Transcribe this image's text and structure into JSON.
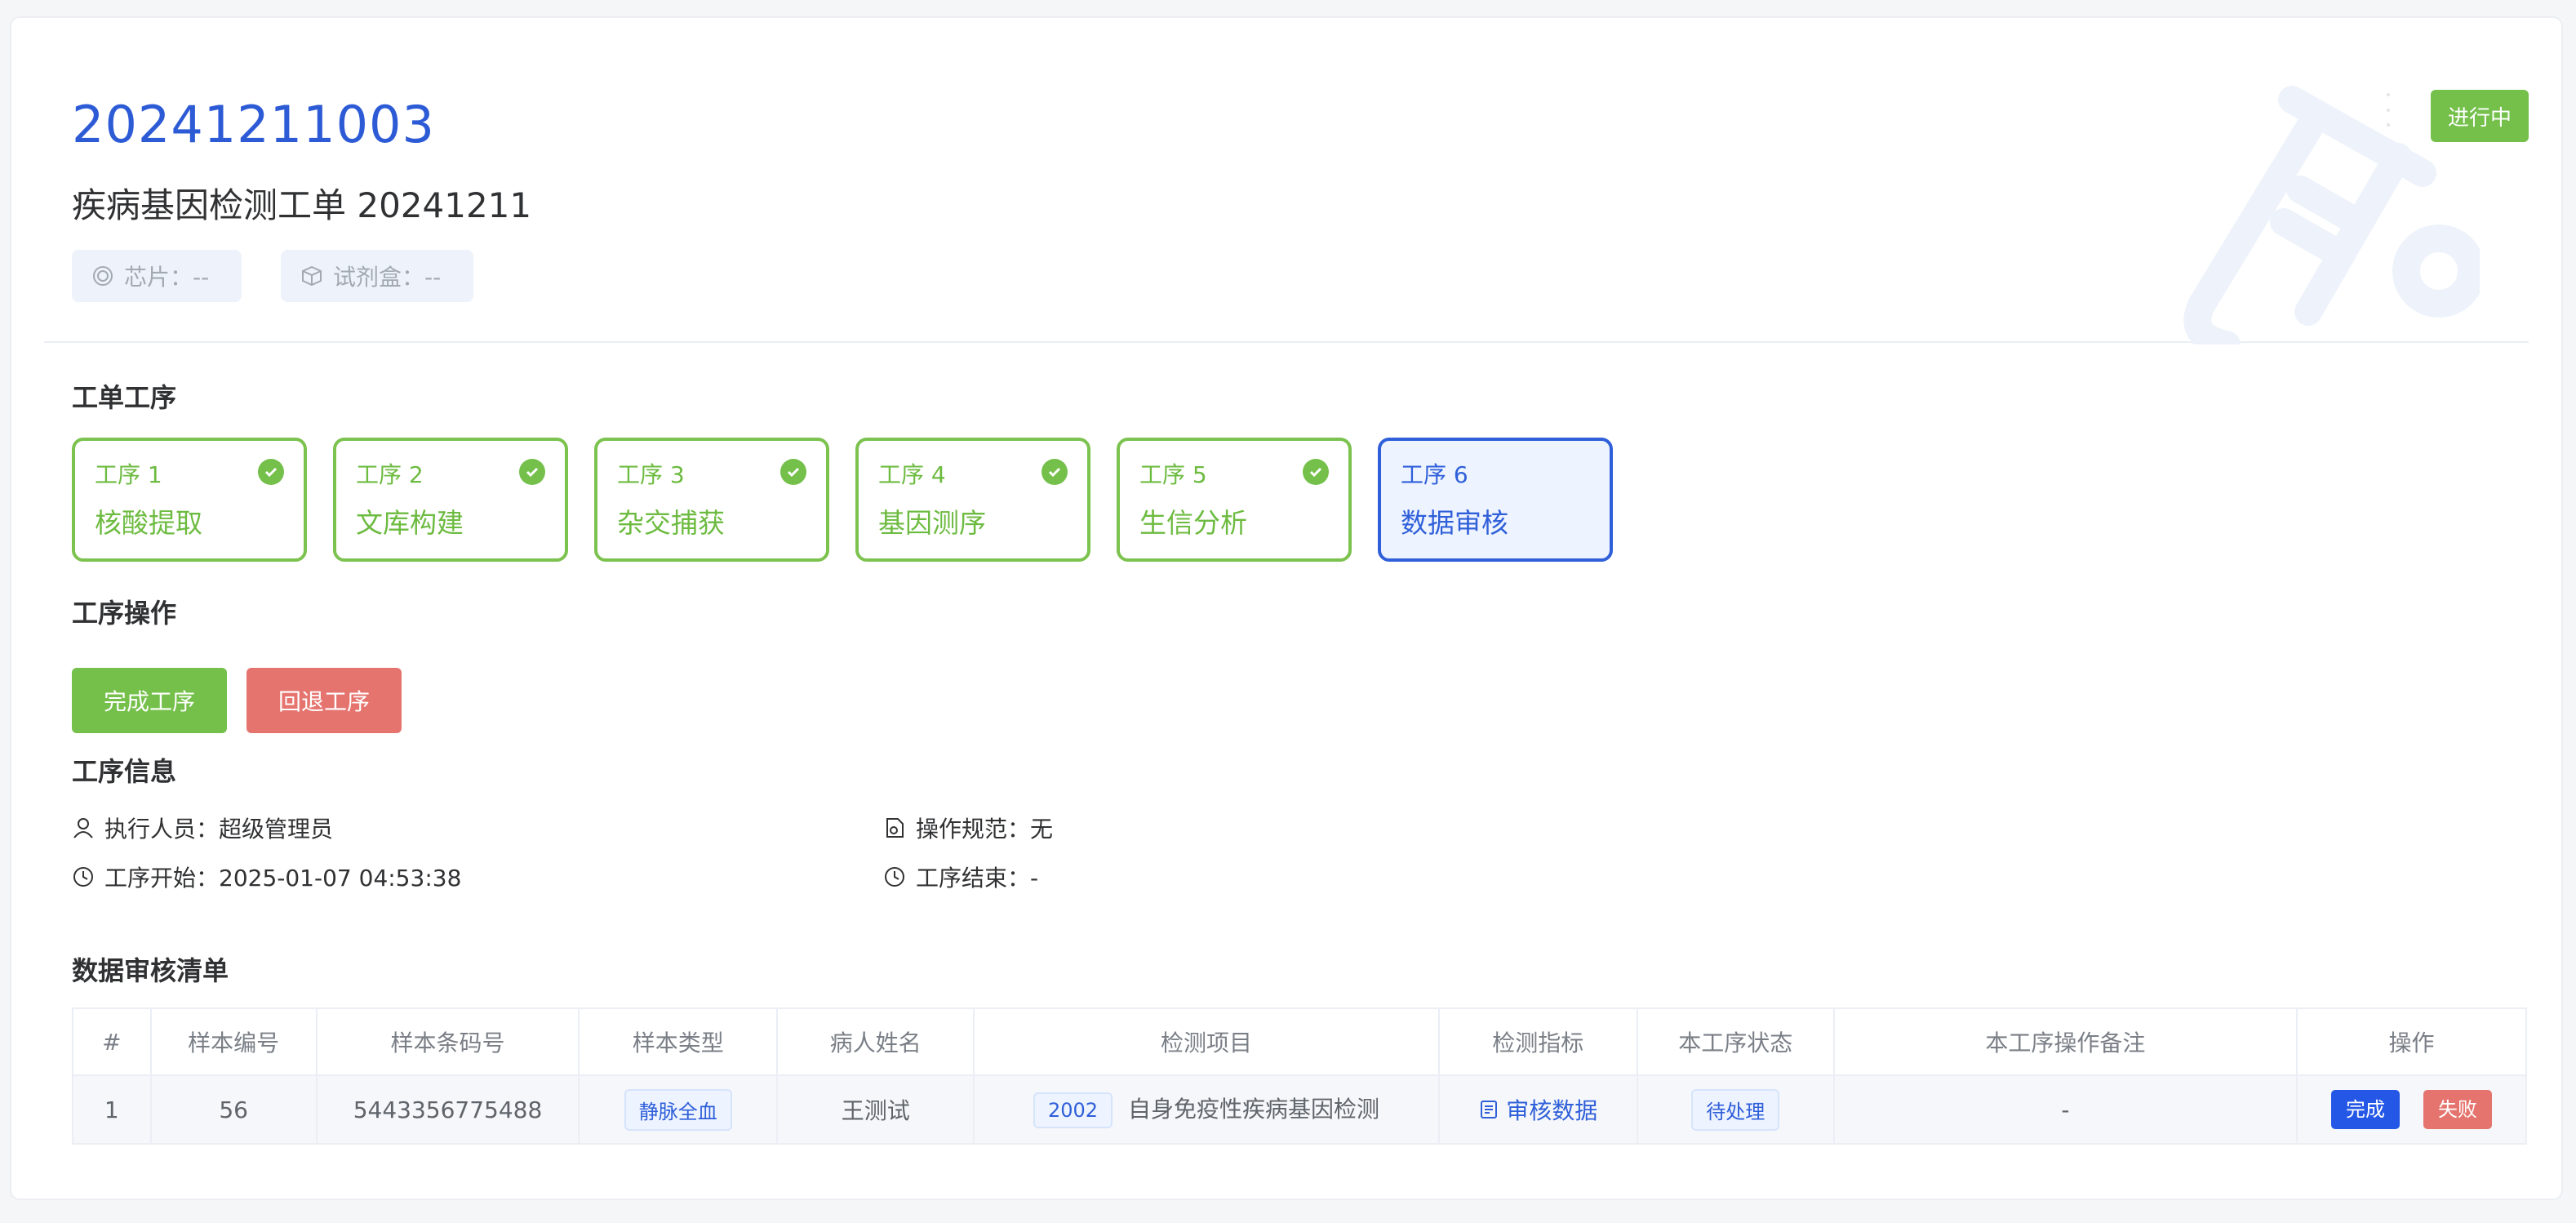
{
  "header": {
    "order_no": "20241211003",
    "order_title": "疾病基因检测工单 20241211",
    "chip": "芯片：--",
    "kit": "试剂盒：--",
    "status": "进行中"
  },
  "steps_section": {
    "title": "工单工序",
    "steps": [
      {
        "num": "工序 1",
        "name": "核酸提取",
        "done": true
      },
      {
        "num": "工序 2",
        "name": "文库构建",
        "done": true
      },
      {
        "num": "工序 3",
        "name": "杂交捕获",
        "done": true
      },
      {
        "num": "工序 4",
        "name": "基因测序",
        "done": true
      },
      {
        "num": "工序 5",
        "name": "生信分析",
        "done": true
      },
      {
        "num": "工序 6",
        "name": "数据审核",
        "done": false
      }
    ]
  },
  "operations": {
    "title": "工序操作",
    "complete_label": "完成工序",
    "rollback_label": "回退工序"
  },
  "info": {
    "title": "工序信息",
    "executor": "执行人员：超级管理员",
    "spec": "操作规范：无",
    "start": "工序开始：2025-01-07 04:53:38",
    "end": "工序结束：-"
  },
  "review": {
    "title": "数据审核清单",
    "columns": [
      "#",
      "样本编号",
      "样本条码号",
      "样本类型",
      "病人姓名",
      "检测项目",
      "检测指标",
      "本工序状态",
      "本工序操作备注",
      "操作"
    ],
    "rows": [
      {
        "index": "1",
        "sample_no": "56",
        "barcode": "5443356775488",
        "sample_type": "静脉全血",
        "patient": "王测试",
        "project_code": "2002",
        "project_name": "自身免疫性疾病基因检测",
        "indicator": "审核数据",
        "status": "待处理",
        "remark": "-",
        "action_complete": "完成",
        "action_fail": "失败"
      }
    ]
  },
  "colors": {
    "primary": "#2f5fd9",
    "success": "#74c04a",
    "danger": "#e5746f"
  }
}
